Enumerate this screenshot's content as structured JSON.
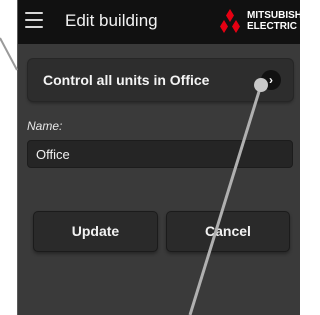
{
  "header": {
    "title": "Edit building",
    "menu_icon": "hamburger-menu-icon",
    "logo_line1": "MITSUBISHI",
    "logo_line2": "ELECTRIC"
  },
  "control": {
    "label": "Control all units in Office",
    "chevron": "›"
  },
  "form": {
    "name_label": "Name:",
    "name_value": "Office"
  },
  "actions": {
    "update_label": "Update",
    "cancel_label": "Cancel"
  },
  "colors": {
    "screen_bg": "#3a3a3a",
    "appbar_bg": "#111111",
    "logo_red": "#e60012"
  }
}
